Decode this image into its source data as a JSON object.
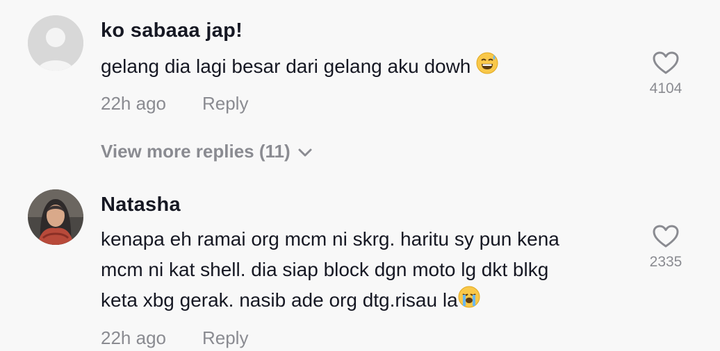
{
  "comments": [
    {
      "username": "ko sabaaa jap!",
      "text": "gelang dia lagi besar dari gelang aku dowh",
      "emoji": "grinning-sweat-face",
      "time": "22h ago",
      "reply_label": "Reply",
      "likes": "4104",
      "avatar": "default-avatar"
    },
    {
      "username": "Natasha",
      "text": "kenapa eh ramai org mcm ni skrg. haritu sy pun kena\nmcm ni kat shell. dia siap block dgn moto lg dkt blkg\nketa xbg gerak. nasib ade org dtg.risau la",
      "emoji": "loudly-crying-face",
      "time": "22h ago",
      "reply_label": "Reply",
      "likes": "2335",
      "avatar": "user-photo-avatar"
    }
  ],
  "view_more": "View more replies (11)",
  "colors": {
    "background": "#f8f8f8",
    "primary_text": "#161823",
    "secondary_text": "#8a8b91"
  }
}
